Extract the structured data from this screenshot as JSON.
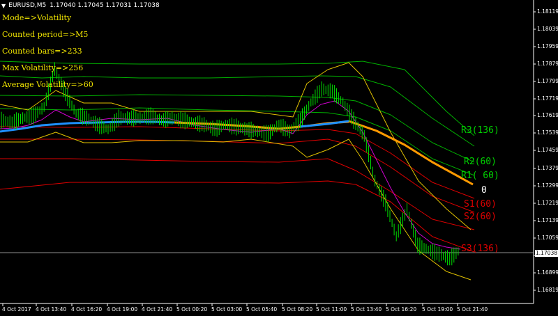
{
  "window": {
    "symbol": "EURUSD,M5",
    "ohlc": "1.17040 1.17045 1.17031 1.17038"
  },
  "info": {
    "mode": "Mode=>Volatility",
    "period": "Counted period=>M5",
    "bars": "Counted bars=>233",
    "max_vol": "Max Volatility=>256",
    "avg_vol": "Average Volatility=>60"
  },
  "levels": {
    "r3": "R3(136)",
    "r2": "R2(60)",
    "r1": "R1( 60)",
    "zero": "0",
    "s1": "S1(60)",
    "s2": "S2(60)",
    "s3": "S3(136)"
  },
  "colors": {
    "resistance": "#00d000",
    "support": "#e00000",
    "pivot": "#ffffff",
    "info_text": "#f2e600",
    "ma_blue": "#1e90ff",
    "ma_orange": "#ff9a00"
  },
  "current_price": "1.17038",
  "chart_data": {
    "type": "line",
    "symbol": "EURUSD",
    "timeframe": "M5",
    "yticks": [
      "1.18119",
      "1.18039",
      "1.17959",
      "1.17879",
      "1.17799",
      "1.17719",
      "1.17619",
      "1.17539",
      "1.17459",
      "1.17379",
      "1.17299",
      "1.17219",
      "1.17139",
      "1.17059",
      "1.16979",
      "1.16899",
      "1.16819"
    ],
    "xticks": [
      "4 Oct 2017",
      "4 Oct 13:40",
      "4 Oct 16:20",
      "4 Oct 19:00",
      "4 Oct 21:40",
      "5 Oct 00:20",
      "5 Oct 03:00",
      "5 Oct 05:40",
      "5 Oct 08:20",
      "5 Oct 11:00",
      "5 Oct 13:40",
      "5 Oct 16:20",
      "5 Oct 19:00",
      "5 Oct 21:40"
    ],
    "ylim": [
      1.16799,
      1.18159
    ],
    "series": [
      {
        "values": [
          1.1762,
          1.1761,
          1.1763,
          1.1764,
          1.1768,
          1.1785,
          1.1774,
          1.1765,
          1.1763,
          1.176,
          1.1758,
          1.1763,
          1.1763,
          1.1763,
          1.1764,
          1.1762,
          1.1763,
          1.1762,
          1.1761,
          1.176,
          1.1758,
          1.176,
          1.1759,
          1.1758,
          1.1757,
          1.1756,
          1.176,
          1.1757,
          1.1762,
          1.177,
          1.1776,
          1.1775,
          1.177,
          1.1762,
          1.1755,
          1.1735,
          1.1725,
          1.171,
          1.1722,
          1.1706,
          1.1704,
          1.1702,
          1.17,
          1.1704
        ]
      }
    ]
  }
}
